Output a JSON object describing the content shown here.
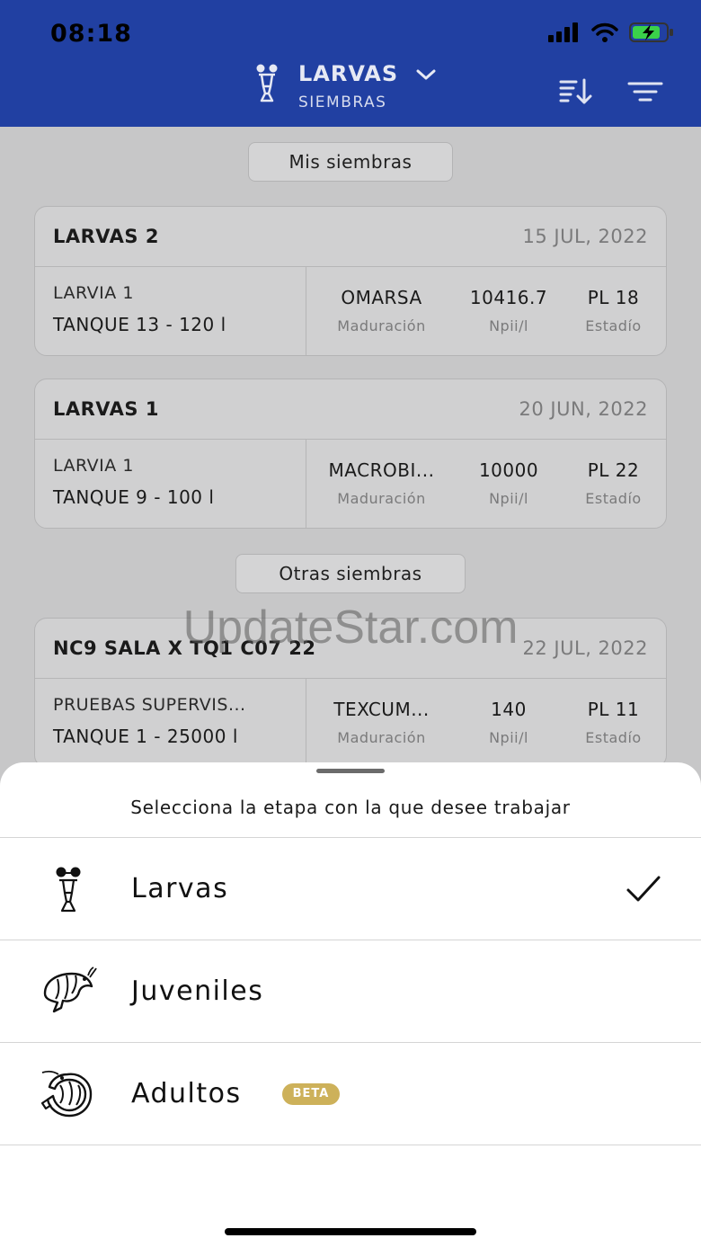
{
  "status_bar": {
    "time": "08:18"
  },
  "header": {
    "title": "LARVAS",
    "subtitle": "SIEMBRAS"
  },
  "sections": {
    "mine": "Mis siembras",
    "others": "Otras siembras"
  },
  "cards": [
    {
      "name": "LARVAS 2",
      "date": "15 JUL, 2022",
      "line1": "LARVIA 1",
      "line2": "TANQUE 13 - 120 l",
      "stats": [
        {
          "value": "OMARSA",
          "label": "Maduración"
        },
        {
          "value": "10416.7",
          "label": "Npii/l"
        },
        {
          "value": "PL 18",
          "label": "Estadío"
        }
      ]
    },
    {
      "name": "LARVAS 1",
      "date": "20 JUN, 2022",
      "line1": "LARVIA 1",
      "line2": "TANQUE 9 - 100 l",
      "stats": [
        {
          "value": "MACROBI...",
          "label": "Maduración"
        },
        {
          "value": "10000",
          "label": "Npii/l"
        },
        {
          "value": "PL 22",
          "label": "Estadío"
        }
      ]
    },
    {
      "name": "NC9 SALA X TQ1 C07 22",
      "date": "22 JUL, 2022",
      "line1": "PRUEBAS SUPERVIS...",
      "line2": "TANQUE 1 - 25000 l",
      "stats": [
        {
          "value": "TEXCUM...",
          "label": "Maduración"
        },
        {
          "value": "140",
          "label": "Npii/l"
        },
        {
          "value": "PL 11",
          "label": "Estadío"
        }
      ]
    }
  ],
  "watermark": "UpdateStar.com",
  "sheet": {
    "title": "Selecciona la etapa con la que desee trabajar",
    "options": [
      {
        "label": "Larvas",
        "icon": "larva-icon",
        "selected": true
      },
      {
        "label": "Juveniles",
        "icon": "shrimp-icon",
        "selected": false
      },
      {
        "label": "Adultos",
        "icon": "adult-shrimp-icon",
        "selected": false,
        "badge": "BETA"
      }
    ]
  },
  "colors": {
    "header_bg": "#2140a2",
    "beta_badge": "#cdb15a",
    "overlay_bg": "#c7c7c8"
  }
}
